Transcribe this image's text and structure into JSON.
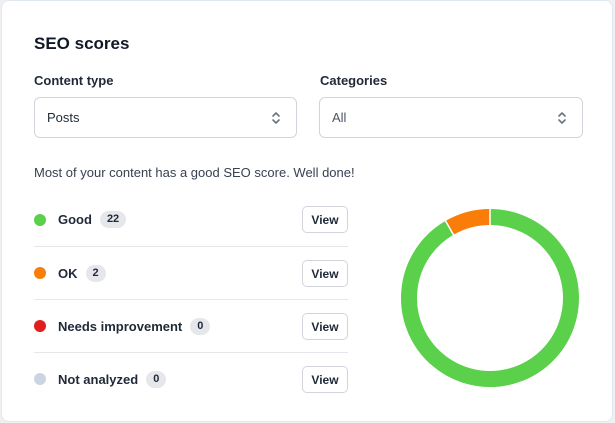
{
  "card": {
    "title": "SEO scores",
    "message": "Most of your content has a good SEO score. Well done!"
  },
  "filters": {
    "content_type": {
      "label": "Content type",
      "value": "Posts"
    },
    "categories": {
      "label": "Categories",
      "value": "All"
    }
  },
  "scores": [
    {
      "label": "Good",
      "count": "22",
      "value": 22,
      "color": "#5bd04b",
      "button": "View"
    },
    {
      "label": "OK",
      "count": "2",
      "value": 2,
      "color": "#f97d08",
      "button": "View"
    },
    {
      "label": "Needs improvement",
      "count": "0",
      "value": 0,
      "color": "#e11d1d",
      "button": "View"
    },
    {
      "label": "Not analyzed",
      "count": "0",
      "value": 0,
      "color": "#cbd5e1",
      "button": "View"
    }
  ],
  "icons": {
    "select_chevron": "chevron-up-down-icon",
    "status": "status-dot-icon"
  }
}
